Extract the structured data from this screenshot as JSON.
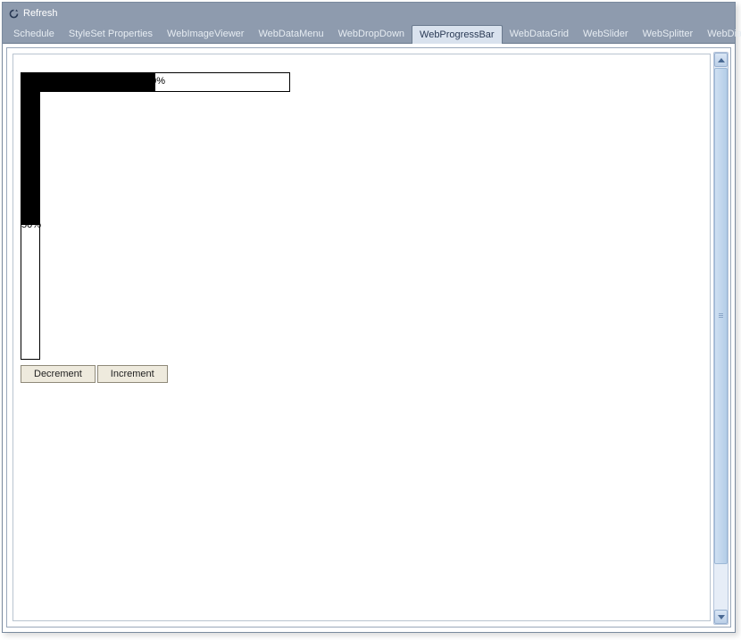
{
  "titlebar": {
    "title": "Refresh"
  },
  "tabs": {
    "items": [
      {
        "label": "Schedule"
      },
      {
        "label": "StyleSet Properties"
      },
      {
        "label": "WebImageViewer"
      },
      {
        "label": "WebDataMenu"
      },
      {
        "label": "WebDropDown"
      },
      {
        "label": "WebProgressBar"
      },
      {
        "label": "WebDataGrid"
      },
      {
        "label": "WebSlider"
      },
      {
        "label": "WebSplitter"
      },
      {
        "label": "WebDialog"
      }
    ],
    "activeIndex": 5
  },
  "progress": {
    "horizontal": {
      "percent": 50,
      "label": "50%"
    },
    "vertical": {
      "percent": 50,
      "label": "50%"
    }
  },
  "buttons": {
    "decrement": "Decrement",
    "increment": "Increment"
  }
}
